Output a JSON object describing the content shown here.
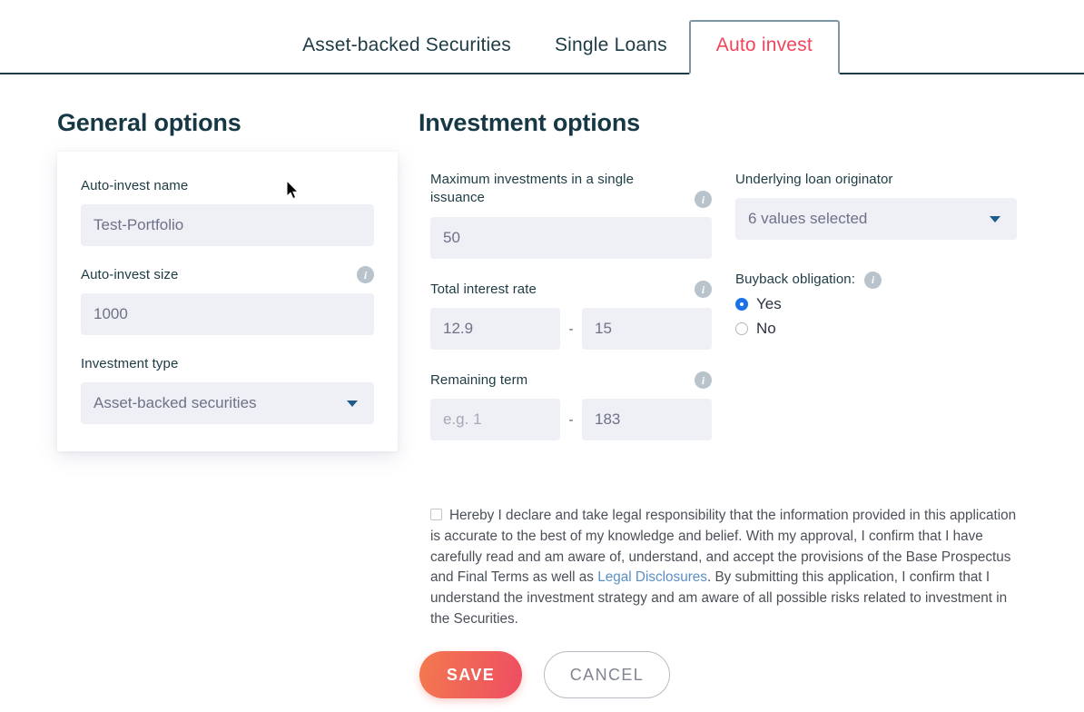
{
  "tabs": [
    {
      "label": "Asset-backed Securities",
      "active": false
    },
    {
      "label": "Single Loans",
      "active": false
    },
    {
      "label": "Auto invest",
      "active": true
    }
  ],
  "general": {
    "title": "General options",
    "name_label": "Auto-invest name",
    "name_value": "Test-Portfolio",
    "size_label": "Auto-invest size",
    "size_value": "1000",
    "type_label": "Investment type",
    "type_value": "Asset-backed securities"
  },
  "investment": {
    "title": "Investment options",
    "max_label": "Maximum investments in a single issuance",
    "max_value": "50",
    "rate_label": "Total interest rate",
    "rate_min": "12.9",
    "rate_max": "15",
    "term_label": "Remaining term",
    "term_min_placeholder": "e.g. 1",
    "term_max": "183",
    "range_separator": "-"
  },
  "originator": {
    "label": "Underlying loan originator",
    "value": "6 values selected"
  },
  "buyback": {
    "label": "Buyback obligation:",
    "options": [
      {
        "label": "Yes",
        "selected": true
      },
      {
        "label": "No",
        "selected": false
      }
    ]
  },
  "disclaimer": {
    "checked": false,
    "part1": "Hereby I declare and take legal responsibility that the information provided in this application is accurate to the best of my knowledge and belief. With my approval, I confirm that I have carefully read and am aware of, understand, and accept the provisions of the Base Prospectus and Final Terms as well as ",
    "link": "Legal Disclosures",
    "part2": ". By submitting this application, I confirm that I understand the investment strategy and am aware of all possible risks related to investment in the Securities."
  },
  "actions": {
    "save_label": "SAVE",
    "cancel_label": "CANCEL"
  },
  "icons": {
    "info": "i"
  },
  "colors": {
    "heading": "#163844",
    "active_tab": "#f0445b",
    "tab_text": "#1d3b44",
    "input_bg": "#eef0f6",
    "link": "#5a8fc4",
    "radio_selected": "#1a73e8",
    "save_gradient_from": "#f3794f",
    "save_gradient_to": "#ee4d62"
  }
}
